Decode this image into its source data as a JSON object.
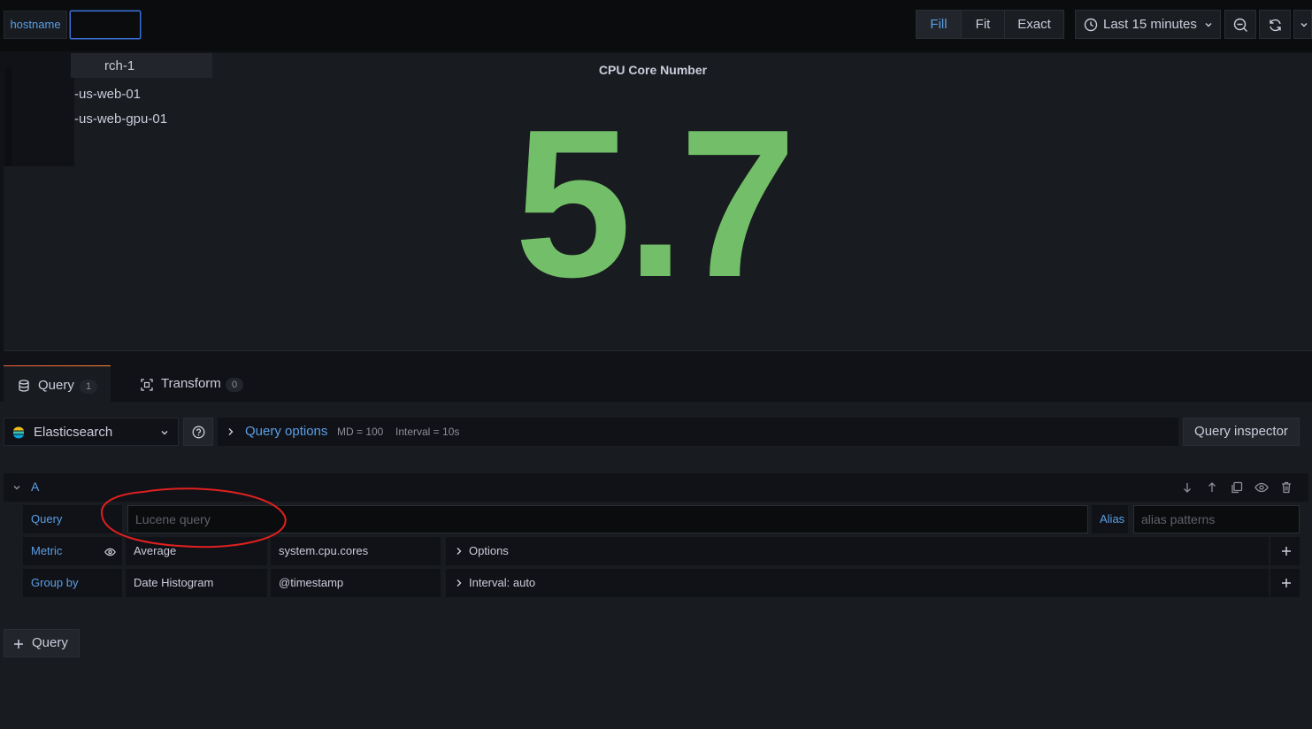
{
  "toolbar": {
    "variable_label": "hostname",
    "variable_value": "",
    "fill": "Fill",
    "fit": "Fit",
    "exact": "Exact",
    "time_range": "Last 15 minutes"
  },
  "dropdown": {
    "options": [
      "rch-1",
      "-us-web-01",
      "-us-web-gpu-01"
    ]
  },
  "panel": {
    "title": "CPU Core Number",
    "value": "5.7",
    "value_color": "#73bf69"
  },
  "tabs": [
    {
      "label": "Query",
      "count": "1"
    },
    {
      "label": "Transform",
      "count": "0"
    }
  ],
  "editor": {
    "datasource": "Elasticsearch",
    "query_options_label": "Query options",
    "md": "MD = 100",
    "interval": "Interval = 10s",
    "query_inspector": "Query inspector",
    "query_ref": "A",
    "query_label": "Query",
    "query_placeholder": "Lucene query",
    "alias_label": "Alias",
    "alias_placeholder": "alias patterns",
    "metric_label": "Metric",
    "metric_type": "Average",
    "metric_field": "system.cpu.cores",
    "metric_options": "Options",
    "groupby_label": "Group by",
    "groupby_type": "Date Histogram",
    "groupby_field": "@timestamp",
    "groupby_interval": "Interval: auto",
    "add_query": "Query"
  },
  "colors": {
    "accent_blue": "#5a9fe6",
    "annotation_red": "#e02020",
    "tab_active_gradient": "#ff8833"
  }
}
